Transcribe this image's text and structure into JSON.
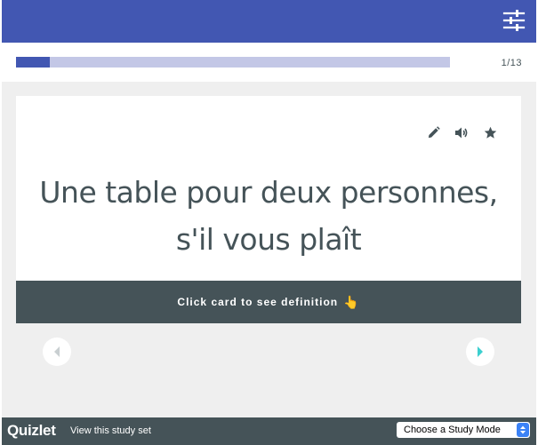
{
  "progress": {
    "current_label": "1/13",
    "fraction": 0.0769
  },
  "card": {
    "term_line1": "Une table pour deux personnes,",
    "term_line2": "s'il vous plaît",
    "footer_text": "Click card to see definition"
  },
  "footer": {
    "brand": "Quizlet",
    "study_link": "View this study set",
    "mode_select_value": "Choose a Study Mode"
  },
  "icons": {
    "settings": "sliders-icon",
    "edit": "pencil-icon",
    "audio": "speaker-icon",
    "star": "star-icon",
    "hand": "pointing-hand-icon",
    "prev": "chevron-left-icon",
    "next": "chevron-right-icon"
  },
  "colors": {
    "brand_blue": "#4257b2",
    "progress_track": "#c3c7e6",
    "dark_slate": "#455358",
    "background": "#efefef",
    "nav_next_accent": "#3ccfcf",
    "nav_prev_disabled": "#c9cfd1"
  }
}
